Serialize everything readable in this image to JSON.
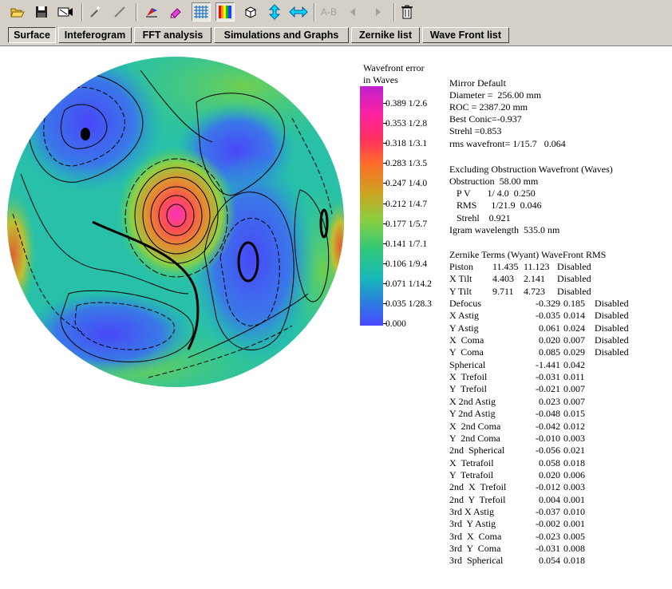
{
  "toolbar": {
    "buttons": [
      {
        "name": "open-folder-icon"
      },
      {
        "name": "save-disk-icon"
      },
      {
        "name": "camera-icon"
      },
      {
        "name": "magic-wand-icon"
      },
      {
        "name": "line-tool-icon"
      },
      {
        "name": "edit-palette-icon"
      },
      {
        "name": "eraser-icon"
      },
      {
        "name": "grid-icon"
      },
      {
        "name": "color-bars-icon"
      },
      {
        "name": "3d-cube-icon"
      },
      {
        "name": "vertical-arrows-icon"
      },
      {
        "name": "horizontal-arrows-icon"
      },
      {
        "name": "ab-text",
        "label": "A-B"
      },
      {
        "name": "arrow-left-icon"
      },
      {
        "name": "arrow-right-icon"
      },
      {
        "name": "trash-icon"
      }
    ]
  },
  "tabs": [
    {
      "label": "Surface",
      "active": true
    },
    {
      "label": "Inteferogram"
    },
    {
      "label": "FFT analysis"
    },
    {
      "label": "Simulations and Graphs"
    },
    {
      "label": "Zernike list"
    },
    {
      "label": "Wave Front list"
    }
  ],
  "legend": {
    "title_line1": "Wavefront error",
    "title_line2": "in Waves",
    "ticks": [
      "0.389 1/2.6",
      "0.353 1/2.8",
      "0.318 1/3.1",
      "0.283 1/3.5",
      "0.247 1/4.0",
      "0.212 1/4.7",
      "0.177 1/5.7",
      "0.141 1/7.1",
      "0.106 1/9.4",
      "0.071 1/14.2",
      "0.035 1/28.3",
      "0.000"
    ]
  },
  "info_lines": [
    "Mirror Default",
    "Diameter =  256.00 mm",
    "ROC = 2387.20 mm",
    "Best Conic=-0.937",
    "Strehl =0.853",
    "rms wavefront= 1/15.7   0.064",
    "",
    "Excluding Obstruction Wavefront (Waves)",
    "Obstruction  58.00 mm",
    "   P V       1/ 4.0  0.250",
    "   RMS      1/21.9  0.046",
    "   Strehl    0.921",
    "Igram wavelength  535.0 nm"
  ],
  "zernike_header": "Zernike Terms (Wyant) WaveFront RMS",
  "zernike_top": [
    {
      "name": "Piston",
      "value": "11.435",
      "rms": "11.123",
      "status": "Disabled"
    },
    {
      "name": "X Tilt",
      "value": "4.403",
      "rms": "2.141",
      "status": "Disabled"
    },
    {
      "name": "Y Tilt",
      "value": "9.711",
      "rms": "4.723",
      "status": "Disabled"
    }
  ],
  "zernike_terms": [
    {
      "name": "Defocus",
      "value": "-0.329",
      "rms": "0.185",
      "status": "Disabled"
    },
    {
      "name": "X Astig",
      "value": "-0.035",
      "rms": "0.014",
      "status": "Disabled"
    },
    {
      "name": "Y Astig",
      "value": "0.061",
      "rms": "0.024",
      "status": "Disabled"
    },
    {
      "name": "X  Coma",
      "value": "0.020",
      "rms": "0.007",
      "status": "Disabled"
    },
    {
      "name": "Y  Coma",
      "value": "0.085",
      "rms": "0.029",
      "status": "Disabled"
    },
    {
      "name": "Spherical",
      "value": "-1.441",
      "rms": "0.042",
      "status": ""
    },
    {
      "name": "X  Trefoil",
      "value": "-0.031",
      "rms": "0.011",
      "status": ""
    },
    {
      "name": "Y  Trefoil",
      "value": "-0.021",
      "rms": "0.007",
      "status": ""
    },
    {
      "name": "X 2nd Astig",
      "value": "0.023",
      "rms": "0.007",
      "status": ""
    },
    {
      "name": "Y 2nd Astig",
      "value": "-0.048",
      "rms": "0.015",
      "status": ""
    },
    {
      "name": "X  2nd Coma",
      "value": "-0.042",
      "rms": "0.012",
      "status": ""
    },
    {
      "name": "Y  2nd Coma",
      "value": "-0.010",
      "rms": "0.003",
      "status": ""
    },
    {
      "name": "2nd  Spherical",
      "value": "-0.056",
      "rms": "0.021",
      "status": ""
    },
    {
      "name": "X  Tetrafoil",
      "value": "0.058",
      "rms": "0.018",
      "status": ""
    },
    {
      "name": "Y  Tetrafoil",
      "value": "0.020",
      "rms": "0.006",
      "status": ""
    },
    {
      "name": "2nd  X  Trefoil",
      "value": "-0.012",
      "rms": "0.003",
      "status": ""
    },
    {
      "name": "2nd  Y  Trefoil",
      "value": "0.004",
      "rms": "0.001",
      "status": ""
    },
    {
      "name": "3rd X Astig",
      "value": "-0.037",
      "rms": "0.010",
      "status": ""
    },
    {
      "name": "3rd  Y Astig",
      "value": "-0.002",
      "rms": "0.001",
      "status": ""
    },
    {
      "name": "3rd  X  Coma",
      "value": "-0.023",
      "rms": "0.005",
      "status": ""
    },
    {
      "name": "3rd  Y  Coma",
      "value": "-0.031",
      "rms": "0.008",
      "status": ""
    },
    {
      "name": "3rd  Spherical",
      "value": "0.054",
      "rms": "0.018",
      "status": ""
    }
  ]
}
